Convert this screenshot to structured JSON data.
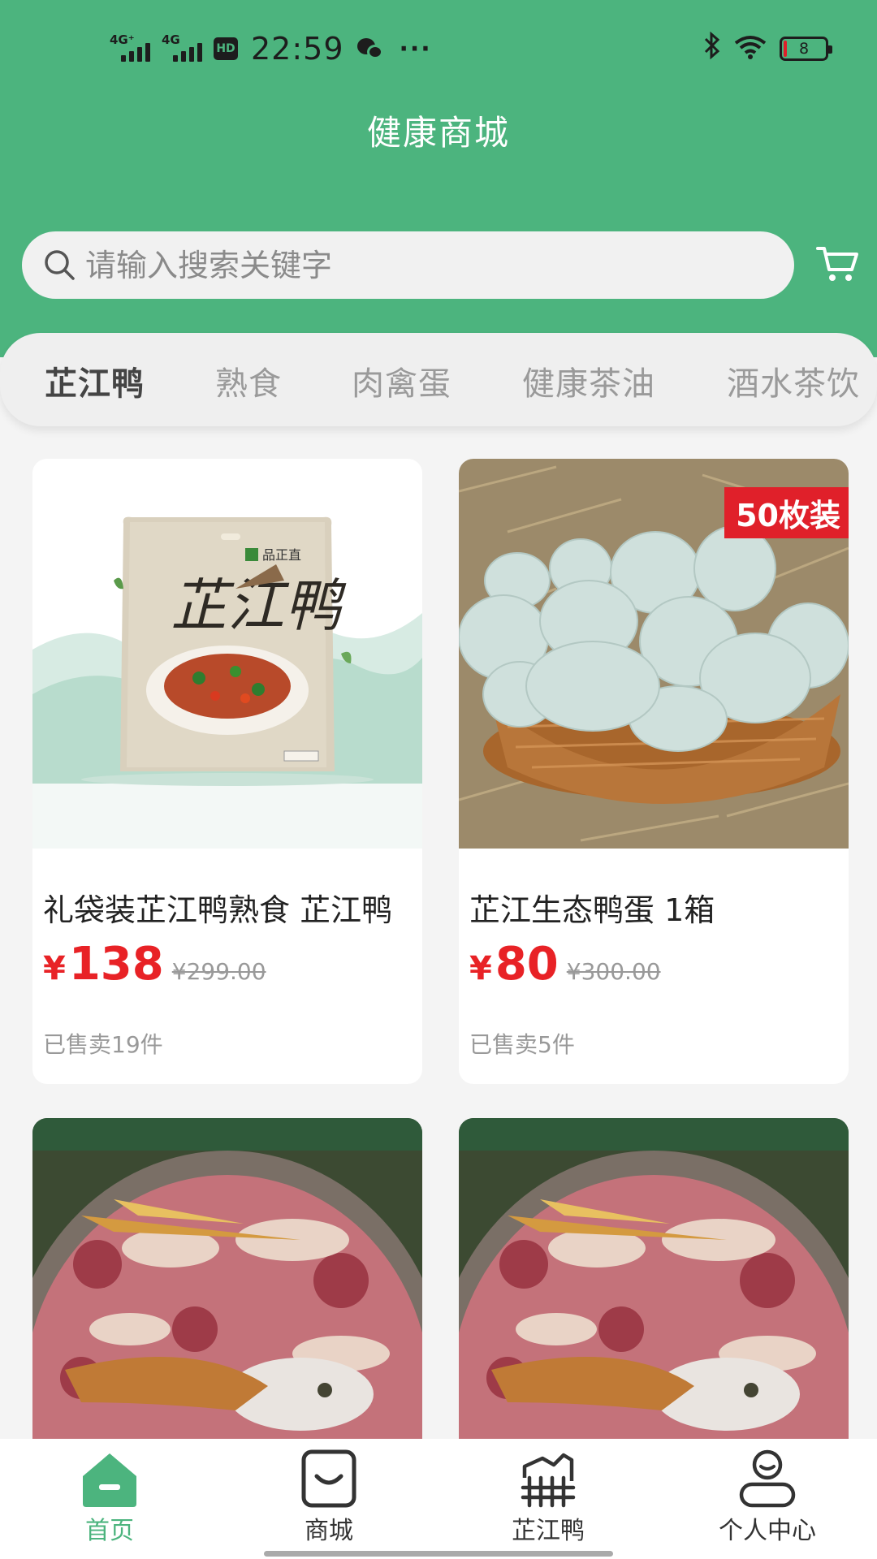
{
  "status_bar": {
    "network1": "4G⁺",
    "network2": "4G",
    "hd": "HD",
    "time": "22:59",
    "more": "···",
    "battery": "8"
  },
  "header": {
    "title": "健康商城"
  },
  "search": {
    "placeholder": "请输入搜索关键字"
  },
  "tabs": [
    {
      "label": "芷江鸭",
      "active": true
    },
    {
      "label": "熟食",
      "active": false
    },
    {
      "label": "肉禽蛋",
      "active": false
    },
    {
      "label": "健康茶油",
      "active": false
    },
    {
      "label": "酒水茶饮",
      "active": false
    }
  ],
  "products": [
    {
      "name": "礼袋装芷江鸭熟食 芷江鸭",
      "price_symbol": "¥",
      "price": "138",
      "original_price": "¥299.00",
      "sold": "已售卖19件",
      "image": "duck-package",
      "package_brand": "品正直",
      "package_title": "芷江鸭"
    },
    {
      "name": "芷江生态鸭蛋 1箱",
      "price_symbol": "¥",
      "price": "80",
      "original_price": "¥300.00",
      "sold": "已售卖5件",
      "image": "duck-eggs-basket",
      "badge": "50枚装"
    },
    {
      "image": "raw-duck-platter"
    },
    {
      "image": "raw-duck-platter"
    }
  ],
  "bottom_nav": [
    {
      "label": "首页",
      "icon": "home-icon",
      "active": true
    },
    {
      "label": "商城",
      "icon": "shop-bag-icon",
      "active": false
    },
    {
      "label": "芷江鸭",
      "icon": "duck-farm-icon",
      "active": false
    },
    {
      "label": "个人中心",
      "icon": "user-icon",
      "active": false
    }
  ],
  "colors": {
    "brand_green": "#4cb47e",
    "price_red": "#e82226",
    "badge_red": "#e0202a"
  }
}
